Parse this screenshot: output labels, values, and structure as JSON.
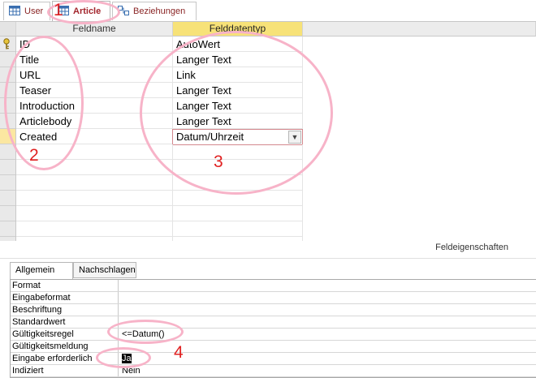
{
  "tabs": [
    {
      "label": "User",
      "icon": "table-icon",
      "active": false
    },
    {
      "label": "Article",
      "icon": "table-icon",
      "active": true
    },
    {
      "label": "Beziehungen",
      "icon": "relationships-icon",
      "active": false
    }
  ],
  "grid": {
    "headers": {
      "field_name": "Feldname",
      "data_type": "Felddatentyp"
    },
    "rows": [
      {
        "name": "ID",
        "type": "AutoWert",
        "key": true
      },
      {
        "name": "Title",
        "type": "Langer Text"
      },
      {
        "name": "URL",
        "type": "Link"
      },
      {
        "name": "Teaser",
        "type": "Langer Text"
      },
      {
        "name": "Introduction",
        "type": "Langer Text"
      },
      {
        "name": "Articlebody",
        "type": "Langer Text"
      },
      {
        "name": "Created",
        "type": "Datum/Uhrzeit",
        "current": true
      }
    ]
  },
  "field_properties": {
    "caption": "Feldeigenschaften",
    "tabs": [
      "Allgemein",
      "Nachschlagen"
    ],
    "rows": [
      {
        "label": "Format",
        "value": ""
      },
      {
        "label": "Eingabeformat",
        "value": ""
      },
      {
        "label": "Beschriftung",
        "value": ""
      },
      {
        "label": "Standardwert",
        "value": ""
      },
      {
        "label": "Gültigkeitsregel",
        "value": "<=Datum()"
      },
      {
        "label": "Gültigkeitsmeldung",
        "value": ""
      },
      {
        "label": "Eingabe erforderlich",
        "value": "Ja"
      },
      {
        "label": "Indiziert",
        "value": "Nein"
      }
    ]
  },
  "annotations": [
    "1",
    "2",
    "3",
    "4"
  ],
  "colors": {
    "annotation_circle": "#f7b3c8",
    "annotation_number": "#e02020",
    "active_header": "#f7e278",
    "current_row": "#fbe7a1"
  }
}
